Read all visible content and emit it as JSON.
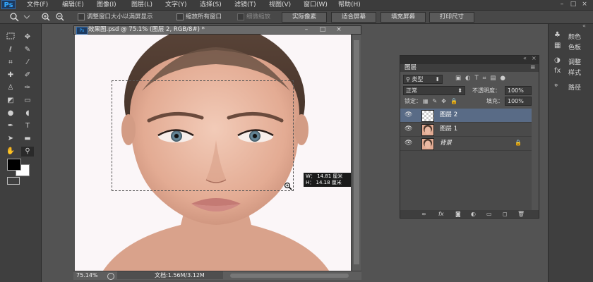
{
  "app": {
    "logo": "Ps"
  },
  "menu": [
    "文件(F)",
    "编辑(E)",
    "图像(I)",
    "图层(L)",
    "文字(Y)",
    "选择(S)",
    "滤镜(T)",
    "视图(V)",
    "窗口(W)",
    "帮助(H)"
  ],
  "window_controls": [
    "–",
    "□",
    "×"
  ],
  "options_bar": {
    "checkbox1_label": "调整窗口大小以满屏显示",
    "checkbox2_label": "缩放所有窗口",
    "checkbox3_label": "细微缩放",
    "btn_actual": "实际像素",
    "btn_fit": "适合屏幕",
    "btn_fill": "填充屏幕",
    "btn_print": "打印尺寸"
  },
  "document": {
    "tab_title": "效果图.psd @ 75.1% (图层 2, RGB/8#) *",
    "zoom": "75.14%",
    "doc_info": "文档:1.56M/3.12M",
    "tooltip_w": "W： 14.81 厘米",
    "tooltip_h": "H： 14.18 厘米"
  },
  "layers_panel": {
    "title": "图层",
    "filter_type": "类型",
    "blend_mode": "正常",
    "opacity_label": "不透明度：",
    "opacity_value": "100%",
    "lock_label": "锁定：",
    "fill_label": "填充：",
    "fill_value": "100%",
    "layers": [
      {
        "name": "图层 2",
        "selected": true
      },
      {
        "name": "图层 1",
        "selected": false
      },
      {
        "name": "背景",
        "selected": false,
        "locked": true
      }
    ],
    "bottom_icons": [
      "link-icon",
      "fx-icon",
      "mask-icon",
      "adjustment-icon",
      "group-icon",
      "new-layer-icon",
      "trash-icon"
    ]
  },
  "side_panels": [
    {
      "label": "颜色",
      "icon": "color-icon"
    },
    {
      "label": "色板",
      "icon": "swatches-icon"
    },
    {
      "label": "调整",
      "icon": "adjust-icon"
    },
    {
      "label": "样式",
      "icon": "styles-icon"
    },
    {
      "label": "路径",
      "icon": "paths-icon"
    }
  ],
  "colors": {
    "accent": "#31a8ff",
    "selected_layer": "#596b86",
    "panel_bg": "#535353"
  }
}
